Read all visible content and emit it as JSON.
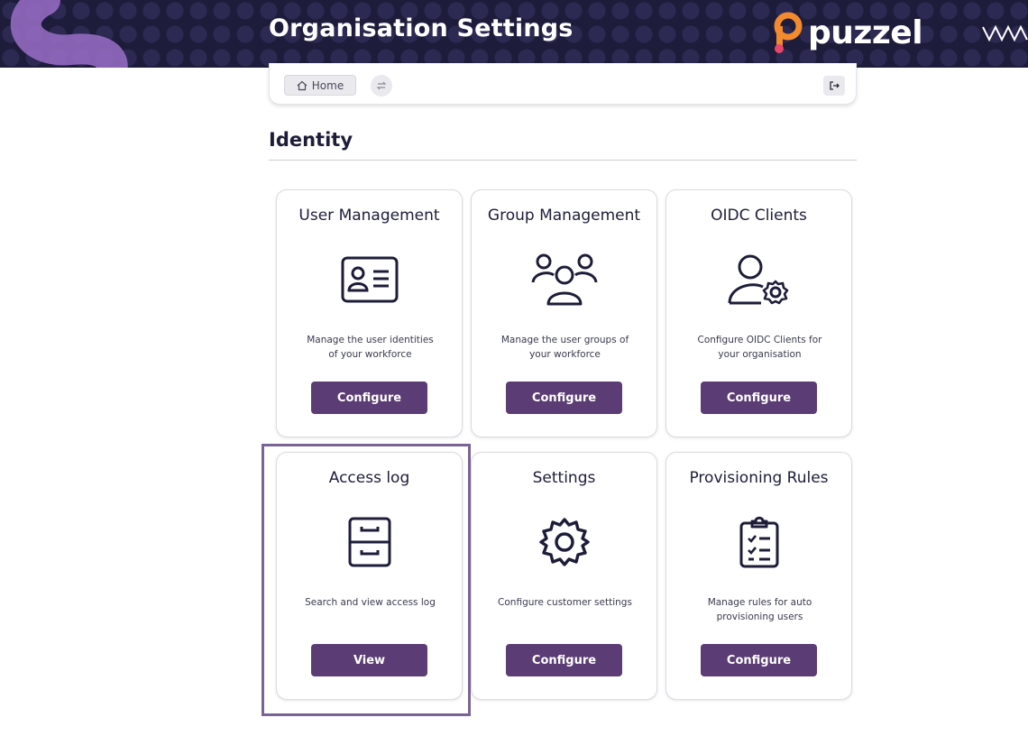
{
  "header": {
    "title": "Organisation Settings",
    "brand": "puzzel",
    "colors": {
      "background": "#1d1c3b",
      "accent": "#f28a2e",
      "swirl": "#9a6fc8"
    }
  },
  "toolbar": {
    "home_label": "Home",
    "home_icon": "home-icon",
    "swap_icon": "swap-icon",
    "logout_icon": "logout-icon"
  },
  "section": {
    "title": "Identity"
  },
  "cards": [
    {
      "title": "User Management",
      "icon": "id-card-icon",
      "description_line1": "Manage the user identities",
      "description_line2": "of your workforce",
      "button": "Configure"
    },
    {
      "title": "Group Management",
      "icon": "users-group-icon",
      "description_line1": "Manage the user groups of",
      "description_line2": "your workforce",
      "button": "Configure"
    },
    {
      "title": "OIDC Clients",
      "icon": "user-gear-icon",
      "description_line1": "Configure OIDC Clients for",
      "description_line2": "your organisation",
      "button": "Configure"
    },
    {
      "title": "Access log",
      "icon": "filing-cabinet-icon",
      "description_line1": "Search and view access log",
      "description_line2": "",
      "button": "View"
    },
    {
      "title": "Settings",
      "icon": "gear-icon",
      "description_line1": "Configure customer settings",
      "description_line2": "",
      "button": "Configure"
    },
    {
      "title": "Provisioning Rules",
      "icon": "clipboard-checklist-icon",
      "description_line1": "Manage rules for auto",
      "description_line2": "provisioning users",
      "button": "Configure"
    }
  ],
  "button_color": "#5b3c74",
  "highlight_color": "#7a6395"
}
